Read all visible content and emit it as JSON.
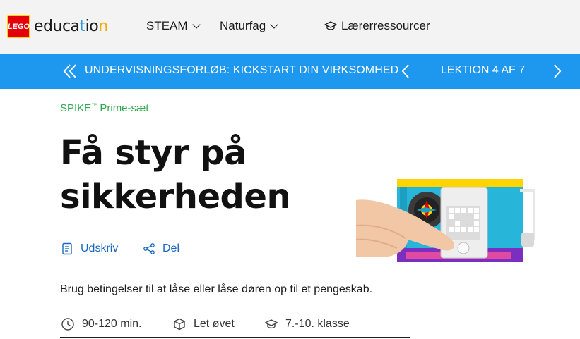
{
  "topnav": {
    "logo_brand": "LEGO",
    "logo_word": "education",
    "items": [
      {
        "label": "STEAM"
      },
      {
        "label": "Naturfag"
      }
    ],
    "teacher_resources": "Lærerressourcer"
  },
  "lesson_bar": {
    "unit_title": "UNDERVISNINGSFORLØB: KICKSTART DIN VIRKSOMHED",
    "lesson_counter": "LEKTION 4 AF 7"
  },
  "main": {
    "product": "SPIKE",
    "product_tm": "™",
    "product_suffix": " Prime-sæt",
    "title": "Få styr på sikkerheden",
    "actions": {
      "print": "Udskriv",
      "share": "Del"
    },
    "description": "Brug betingelser til at låse eller låse døren op til et pengeskab.",
    "meta": {
      "duration": "90-120 min.",
      "level": "Let øvet",
      "grade": "7.-10. klasse"
    }
  },
  "colors": {
    "blue_bar": "#1e98ee",
    "product_green": "#2fa84f",
    "link_blue": "#1668c1",
    "nav_bg": "#f3f3f3"
  }
}
